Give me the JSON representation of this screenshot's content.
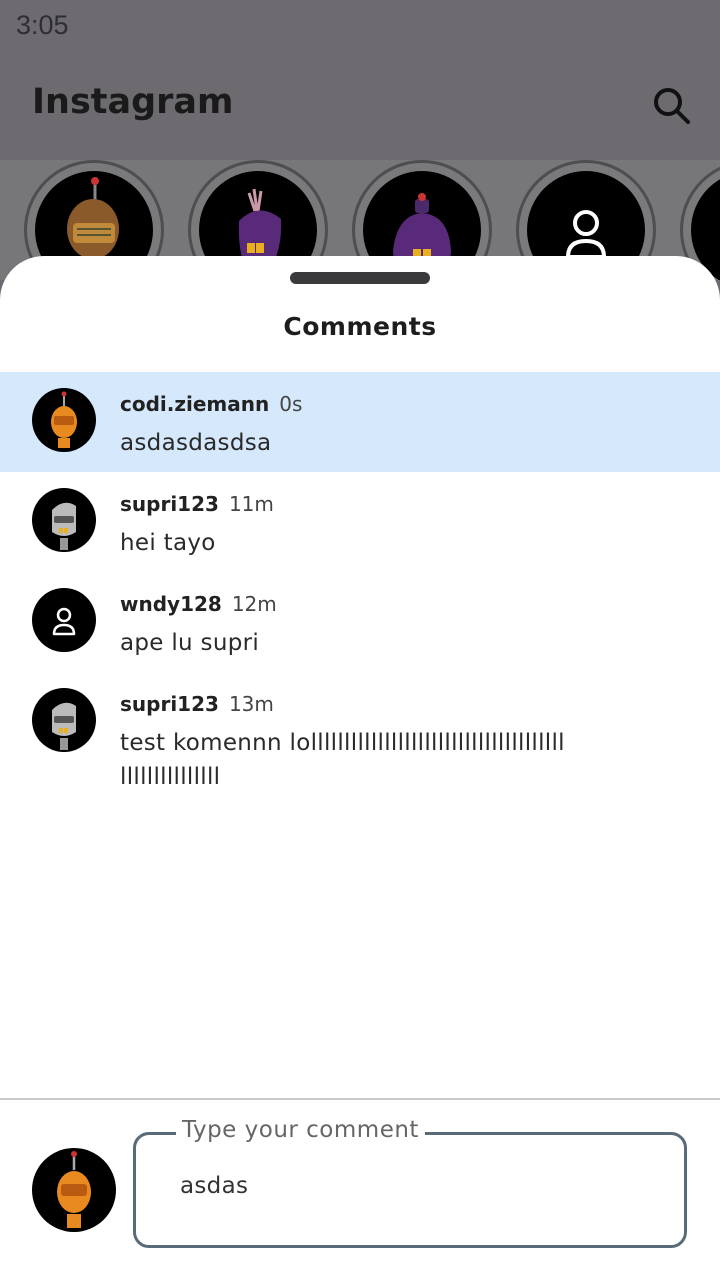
{
  "status_bar": {
    "time": "3:05"
  },
  "app_bar": {
    "title": "Instagram"
  },
  "stories": [
    {
      "icon": "orange-robot-avatar"
    },
    {
      "icon": "purple-eggplant-avatar"
    },
    {
      "icon": "purple-blob-avatar"
    },
    {
      "icon": "default-user-avatar"
    },
    {
      "icon": "partial-avatar"
    }
  ],
  "sheet": {
    "title": "Comments",
    "comments": [
      {
        "user": "codi.ziemann",
        "time": "0s",
        "text": "asdasdasdsa",
        "avatar": "orange-robot-avatar",
        "highlighted": true
      },
      {
        "user": "supri123",
        "time": "11m",
        "text": "hei tayo",
        "avatar": "gray-robot-avatar"
      },
      {
        "user": "wndy128",
        "time": "12m",
        "text": "ape lu supri",
        "avatar": "default-user-avatar"
      },
      {
        "user": "supri123",
        "time": "13m",
        "text": "test komennn lolllllllllllllllllllllllllllllllllllllllllllllllllllll",
        "avatar": "gray-robot-avatar"
      }
    ]
  },
  "composer": {
    "label": "Type your comment",
    "value": "asdas",
    "avatar": "orange-robot-avatar"
  },
  "colors": {
    "highlight": "#d6e8fb",
    "input_border": "#5a6b78",
    "scrim": "#6d6b70"
  }
}
